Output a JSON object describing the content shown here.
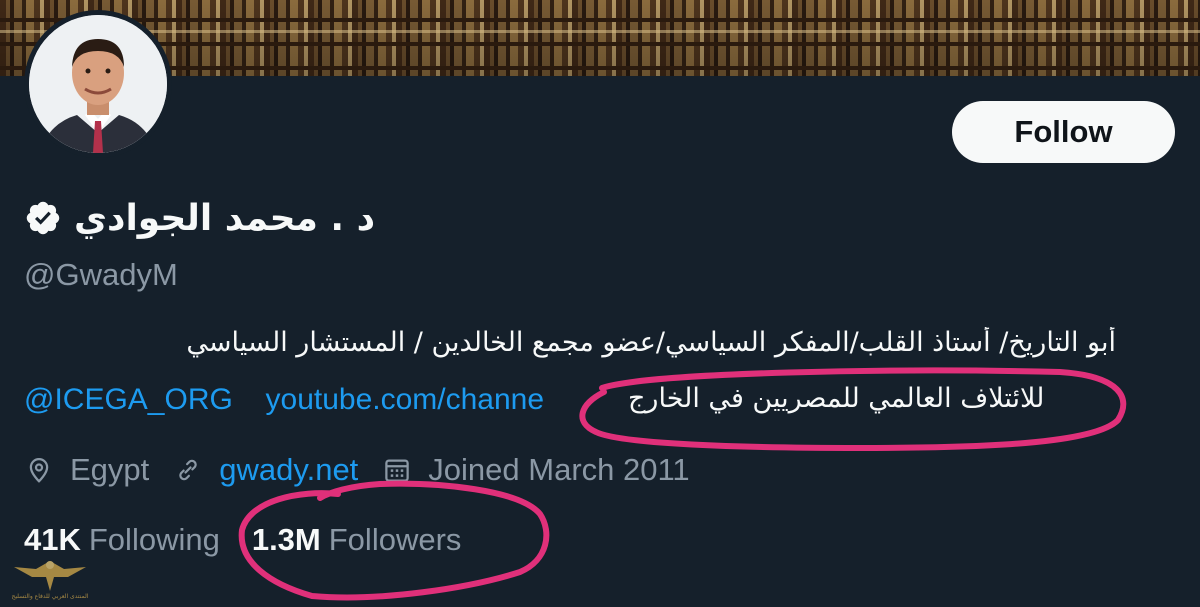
{
  "profile": {
    "display_name": "د . محمد الجوادي",
    "handle": "@GwadyM",
    "verified": true,
    "follow_label": "Follow"
  },
  "bio": {
    "line1": "أبو التاريخ/  أستاذ القلب/المفكر السياسي/عضو مجمع الخالدين /   المستشار السياسي",
    "mention": "@ICEGA_ORG",
    "link": "youtube.com/channe",
    "line2_arabic": "للائتلاف العالمي للمصريين في الخارج"
  },
  "meta": {
    "location": "Egypt",
    "website": "gwady.net",
    "joined": "Joined March 2011",
    "icons": [
      "location-pin-icon",
      "link-icon",
      "calendar-icon"
    ]
  },
  "stats": {
    "following_count": "41K",
    "following_label": "Following",
    "followers_count": "1.3M",
    "followers_label": "Followers"
  },
  "watermark": {
    "text": "المنتدى العربي للدفاع والتسليح"
  },
  "colors": {
    "background": "#15202b",
    "text": "#f7f9f9",
    "secondary_text": "#8b98a5",
    "link": "#1d9bf0",
    "annotation": "#e0307a"
  }
}
